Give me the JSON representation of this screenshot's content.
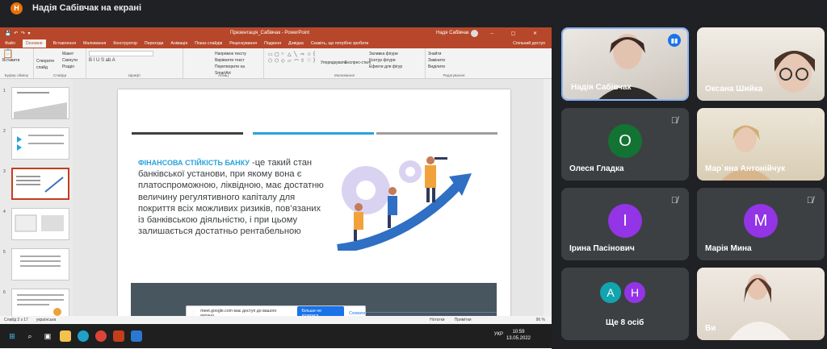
{
  "meet": {
    "presenter_initial": "Н",
    "presenter_banner": "Надія Сабівчак на екрані"
  },
  "ppt": {
    "window_title": "Презентація_Сабівчак - PowerPoint",
    "user": "Надя Сабівчак",
    "tabs": [
      "Файл",
      "Основне",
      "Вставлення",
      "Малювання",
      "Конструктор",
      "Переходи",
      "Анімація",
      "Показ слайдів",
      "Рецензування",
      "Подання",
      "Довідка",
      "Скажіть, що потрібно зробити"
    ],
    "share_label": "Спільний доступ",
    "ribbon": {
      "clipboard": {
        "paste": "Вставити",
        "group": "Буфер обміну"
      },
      "slides": {
        "new": "Створити слайд",
        "layout": "Макет",
        "reset": "Скинути",
        "section": "Розділ",
        "group": "Слайди"
      },
      "font_group": "Шрифт",
      "paragraph": {
        "dir": "Напрямок тексту",
        "align": "Вирівняти текст",
        "smartart": "Перетворити на SmartArt",
        "group": "Абзац"
      },
      "drawing": {
        "arrange": "Упорядкувати",
        "styles": "Експрес-стилі",
        "fill": "Заливка фігури",
        "outline": "Контур фігури",
        "effects": "Ефекти для фігур",
        "group": "Малювання"
      },
      "editing": {
        "find": "Знайти",
        "replace": "Замінити",
        "select": "Виділити",
        "group": "Редагування"
      }
    },
    "slide": {
      "highlight": "ФІНАНСОВА СТІЙКІСТЬ БАНКУ",
      "body": " -це такий стан банківської установи, при якому вона є платоспроможною, ліквідною, має достатню величину регулятивного капіталу для покриття всіх можливих ризиків, пов’язаних із банківською діяльністю, і при цьому залишається достатньо рентабельною",
      "footer_text": "ТЕКСТ СЛАЙДА",
      "date": "12.05.2022"
    },
    "thumb_numbers": [
      "1",
      "2",
      "3",
      "4",
      "5",
      "6"
    ],
    "status": {
      "slide_counter": "Слайд 3 з 17",
      "language": "українська",
      "notes": "Нотатки",
      "comments": "Примітки",
      "zoom": "96 %"
    },
    "share_popup": {
      "message": "meet.google.com має доступ до вашого екрана.",
      "hide": "Більше не ділитися",
      "close": "Сховати"
    },
    "taskbar": {
      "lang": "УКР",
      "time": "10:59",
      "date": "13.05.2022"
    }
  },
  "participants": [
    {
      "name": "Надія Сабівчак",
      "type": "video",
      "speaking": true
    },
    {
      "name": "Оксана Шийка",
      "type": "video"
    },
    {
      "name": "Олеся Гладка",
      "initial": "О",
      "color": "#137333",
      "muted": true
    },
    {
      "name": "Мар`яна Антонійчук",
      "type": "video",
      "muted": true
    },
    {
      "name": "Ірина Пасінович",
      "initial": "І",
      "color": "#9334e6",
      "muted": true
    },
    {
      "name": "Марія Мина",
      "initial": "М",
      "color": "#9334e6",
      "muted": true
    },
    {
      "name": "Ще 8 осіб",
      "initials": [
        "А",
        "Н"
      ],
      "colors": [
        "#12a4af",
        "#9334e6"
      ]
    },
    {
      "name": "Ви",
      "type": "video"
    }
  ]
}
